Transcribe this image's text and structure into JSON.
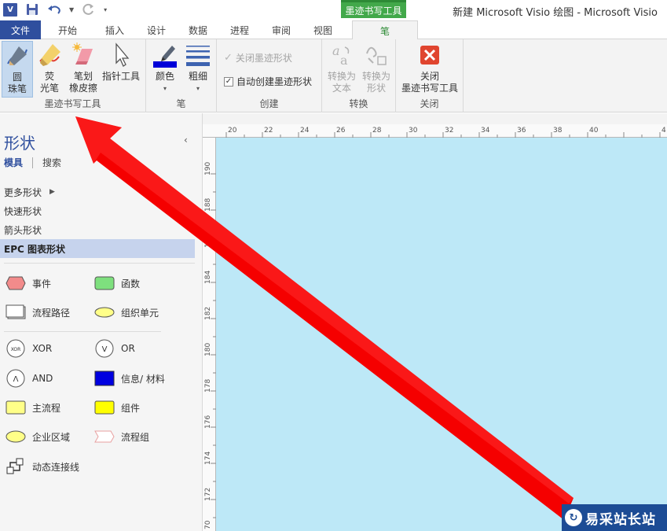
{
  "window": {
    "title": "新建 Microsoft Visio 绘图 - Microsoft Visio",
    "contextual_tab_group": "墨迹书写工具"
  },
  "tabs": [
    "文件",
    "开始",
    "插入",
    "设计",
    "数据",
    "进程",
    "审阅",
    "视图"
  ],
  "active_tab": "笔",
  "ribbon": {
    "group_ink_tools": {
      "label": "墨迹书写工具",
      "pen_line1": "圆",
      "pen_line2": "珠笔",
      "highlighter_line1": "荧",
      "highlighter_line2": "光笔",
      "stroke_eraser_line1": "笔划",
      "stroke_eraser_line2": "橡皮擦",
      "pointer_tool": "指针工具"
    },
    "group_pen": {
      "label": "笔",
      "color": "颜色",
      "weight": "粗细"
    },
    "group_create": {
      "label": "创建",
      "close_ink_shape": "关闭墨迹形状",
      "auto_create_ink_shape": "自动创建墨迹形状"
    },
    "group_convert": {
      "label": "转换",
      "to_text_line1": "转换为",
      "to_text_line2": "文本",
      "to_shapes_line1": "转换为",
      "to_shapes_line2": "形状"
    },
    "group_close": {
      "label": "关闭",
      "close_line1": "关闭",
      "close_line2": "墨迹书写工具"
    }
  },
  "shapes_pane": {
    "title": "形状",
    "tab_stencils": "模具",
    "tab_search": "搜索",
    "stencils": [
      {
        "label": "更多形状"
      },
      {
        "label": "快速形状"
      },
      {
        "label": "箭头形状"
      },
      {
        "label": "EPC 图表形状"
      }
    ],
    "shapes": {
      "event": "事件",
      "function": "函数",
      "process_path": "流程路径",
      "org_unit": "组织单元",
      "xor": "XOR",
      "or": "OR",
      "and": "AND",
      "info_material": "信息/ 材料",
      "main_process": "主流程",
      "component": "组件",
      "enterprise_area": "企业区域",
      "process_group": "流程组",
      "dynamic_connector": "动态连接线"
    },
    "xor_glyph": "XOR",
    "or_glyph": "V",
    "and_glyph": "Λ"
  },
  "ruler": {
    "horizontal": [
      "20",
      "22",
      "24",
      "26",
      "28",
      "30",
      "32",
      "34",
      "36",
      "38",
      "40",
      "4"
    ],
    "vertical": [
      "190",
      "188",
      "18",
      "184",
      "182",
      "180",
      "178",
      "176",
      "174",
      "172",
      "70"
    ]
  },
  "watermark": {
    "text": "易采站长站"
  },
  "colors": {
    "file_tab": "#2f4f9e",
    "context_tab": "#42a84a",
    "page_background": "#bde8f7",
    "arrow": "#ff0000"
  }
}
